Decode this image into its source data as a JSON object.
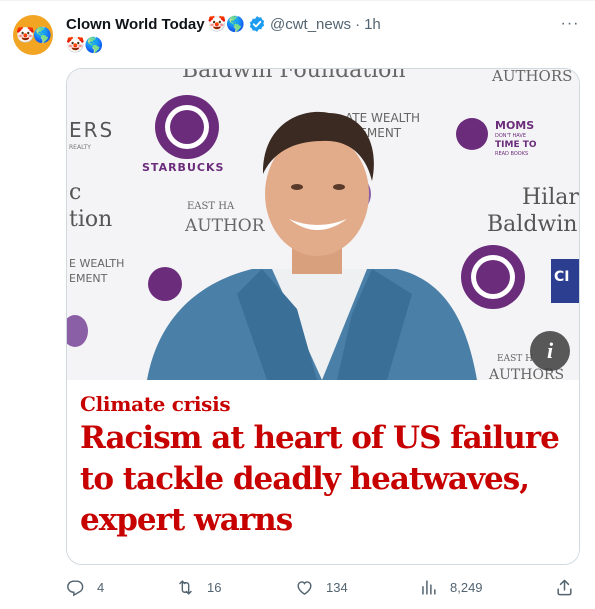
{
  "tweet": {
    "author_name": "Clown World Today",
    "author_emojis": "🤡🌎",
    "handle": "@cwt_news",
    "separator": "·",
    "time": "1h",
    "text": "🤡🌎",
    "avatar_emojis": "🤡🌎",
    "more_label": "···"
  },
  "card": {
    "backdrop_texts": {
      "foundation": "Baldwin Foundation",
      "authors_top": "AUTHORS",
      "ers": "ERS",
      "realty": "REALTY",
      "wealth_top": "ATE WEALTH",
      "management_top": "GEMENT",
      "moms": "MOMS",
      "moms_sub1": "DON'T HAVE",
      "moms_sub2": "TIME TO",
      "moms_sub3": "READ BOOKS",
      "starbucks": "STARBUCKS",
      "east_ha": "EAST HA",
      "authors_mid": "AUTHOR",
      "c": "c",
      "tion": "tion",
      "hilari": "Hilari",
      "baldwin": "Baldwin",
      "wealth_left": "E WEALTH",
      "ement_left": "EMENT",
      "ci": "CI",
      "east_bottom": "EAST H",
      "authors_bottom": "AUTHORS"
    },
    "info_label": "i",
    "kicker": "Climate crisis",
    "headline": "Racism at heart of US failure to tackle deadly heatwaves, expert warns"
  },
  "actions": {
    "replies": "4",
    "retweets": "16",
    "likes": "134",
    "views": "8,249"
  },
  "colors": {
    "headline_red": "#c70000",
    "muted": "#536471",
    "verified_blue": "#1d9bf0",
    "avatar_bg": "#f2a423",
    "starbucks_purple": "#6b2d7b"
  }
}
